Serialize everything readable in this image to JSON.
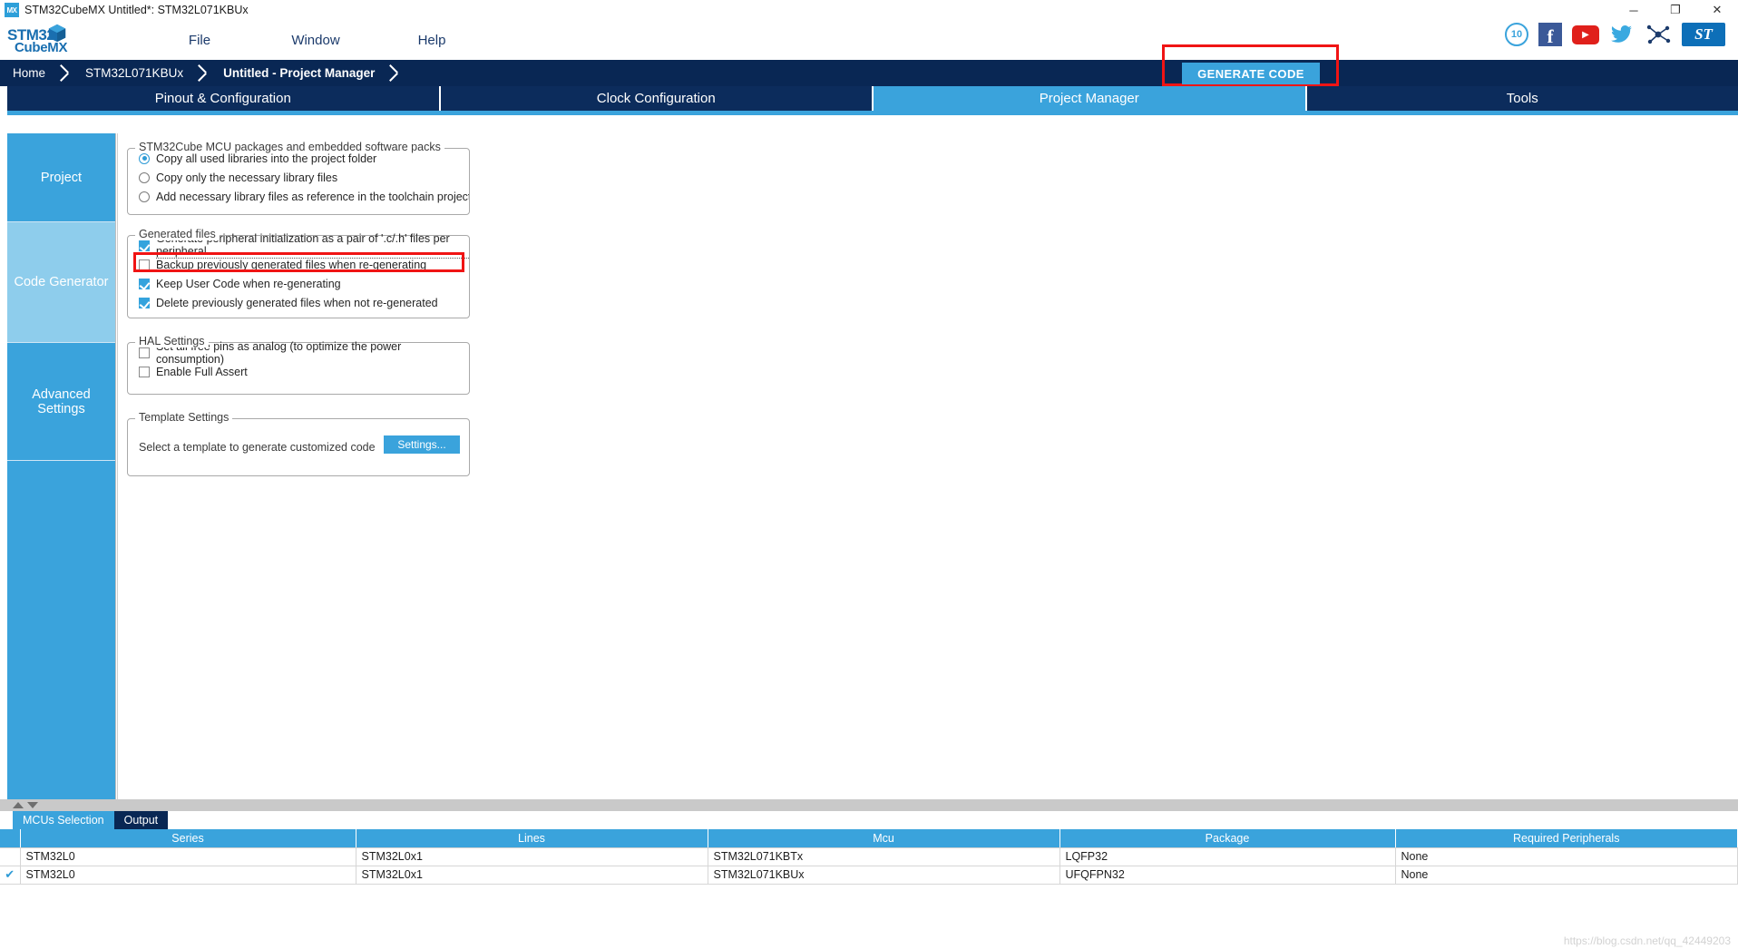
{
  "window": {
    "app_icon": "MX",
    "title": "STM32CubeMX Untitled*: STM32L071KBUx",
    "minimize": "─",
    "restore": "❐",
    "close": "✕"
  },
  "brand": {
    "line1": "STM32",
    "line2": "CubeMX",
    "st_logo": "ST"
  },
  "menu": {
    "items": [
      {
        "label": "File"
      },
      {
        "label": "Window"
      },
      {
        "label": "Help"
      }
    ]
  },
  "social": {
    "badge": "10",
    "facebook": "f",
    "youtube": "▶",
    "twitter": "🐦",
    "network": "network-icon"
  },
  "breadcrumb": {
    "items": [
      {
        "label": "Home",
        "active": false
      },
      {
        "label": "STM32L071KBUx",
        "active": false
      },
      {
        "label": "Untitled - Project Manager",
        "active": true
      }
    ],
    "generate_code": "GENERATE CODE",
    "highlight_color": "#f01414"
  },
  "main_tabs": [
    {
      "label": "Pinout & Configuration",
      "selected": false
    },
    {
      "label": "Clock Configuration",
      "selected": false
    },
    {
      "label": "Project Manager",
      "selected": true
    },
    {
      "label": "Tools",
      "selected": false
    }
  ],
  "sidebar": {
    "items": [
      {
        "label": "Project",
        "selected": false
      },
      {
        "label": "Code Generator",
        "selected": true
      },
      {
        "label": "Advanced Settings",
        "selected": false
      },
      {
        "label": "",
        "selected": false
      }
    ]
  },
  "groups": {
    "packages": {
      "legend": "STM32Cube MCU packages and embedded software packs",
      "options": [
        {
          "label": "Copy all used libraries into the project folder",
          "checked": true
        },
        {
          "label": "Copy only the necessary library files",
          "checked": false
        },
        {
          "label": "Add necessary library files as reference in the toolchain project configu...",
          "checked": false
        }
      ]
    },
    "generated_files": {
      "legend": "Generated files",
      "options": [
        {
          "label": "Generate peripheral initialization as a pair of '.c/.h' files per peripheral",
          "checked": true,
          "highlighted": true
        },
        {
          "label": "Backup previously generated files when re-generating",
          "checked": false,
          "highlighted": false
        },
        {
          "label": "Keep User Code when re-generating",
          "checked": true,
          "highlighted": false
        },
        {
          "label": "Delete previously generated files when not re-generated",
          "checked": true,
          "highlighted": false
        }
      ]
    },
    "hal_settings": {
      "legend": "HAL Settings",
      "options": [
        {
          "label": "Set all free pins as analog (to optimize the power consumption)",
          "checked": false
        },
        {
          "label": "Enable Full Assert",
          "checked": false
        }
      ]
    },
    "template_settings": {
      "legend": "Template Settings",
      "description": "Select a template to generate customized code",
      "button": "Settings..."
    }
  },
  "bottom": {
    "tabs": [
      {
        "label": "MCUs Selection",
        "selected": true
      },
      {
        "label": "Output",
        "selected": false
      }
    ],
    "table": {
      "columns": [
        "",
        "Series",
        "Lines",
        "Mcu",
        "Package",
        "Required Peripherals"
      ],
      "rows": [
        {
          "mark": "",
          "cells": [
            "STM32L0",
            "STM32L0x1",
            "STM32L071KBTx",
            "LQFP32",
            "None"
          ]
        },
        {
          "mark": "✔",
          "cells": [
            "STM32L0",
            "STM32L0x1",
            "STM32L071KBUx",
            "UFQFPN32",
            "None"
          ]
        }
      ]
    },
    "watermark": "https://blog.csdn.net/qq_42449203"
  },
  "colors": {
    "accent": "#3aa3dc",
    "navy": "#092754",
    "tab_navy": "#0c2c5c",
    "highlight": "#f01414",
    "sidebar_selected": "#8ecdec"
  }
}
